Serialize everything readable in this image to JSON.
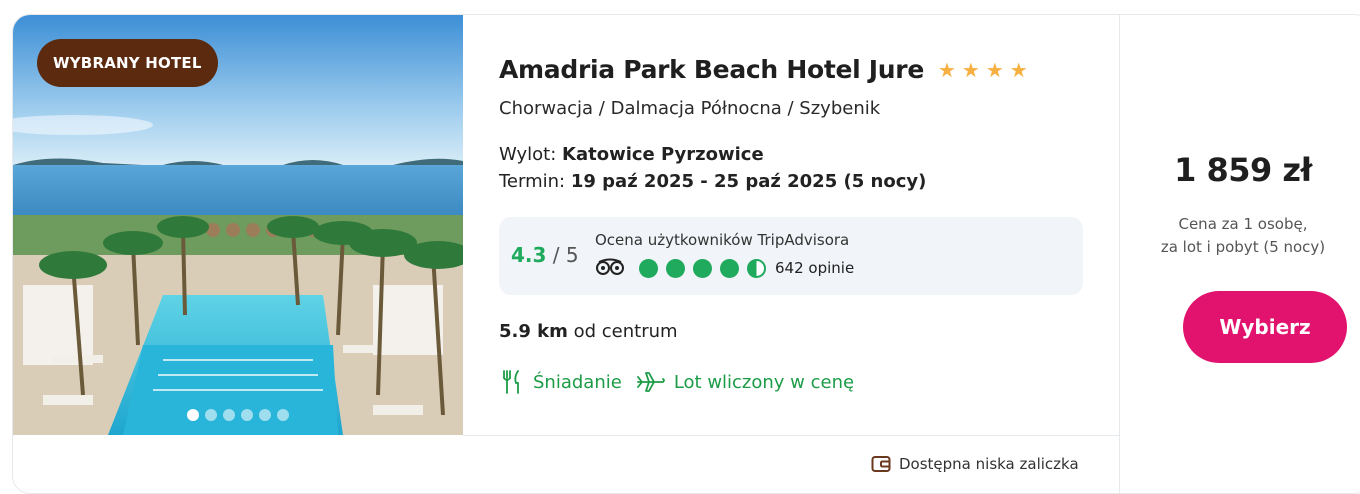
{
  "badge": "WYBRANY HOTEL",
  "hotel": {
    "name": "Amadria Park Beach Hotel Jure",
    "stars": 4,
    "location": "Chorwacja / Dalmacja Północna / Szybenik"
  },
  "trip": {
    "departure_label": "Wylot:",
    "departure_value": "Katowice Pyrzowice",
    "term_label": "Termin:",
    "term_value": "19 paź 2025 - 25 paź 2025 (5 nocy)"
  },
  "rating": {
    "score": "4.3",
    "scale": "/ 5",
    "label": "Ocena użytkowników TripAdvisora",
    "bubbles": 4.5,
    "reviews": "642 opinie"
  },
  "distance": {
    "value": "5.9 km",
    "suffix": "od centrum"
  },
  "features": [
    {
      "icon": "fork-knife-icon",
      "label": "Śniadanie"
    },
    {
      "icon": "airplane-icon",
      "label": "Lot wliczony w cenę"
    }
  ],
  "deposit": "Dostępna niska zaliczka",
  "gallery": {
    "count": 6,
    "active": 0
  },
  "price": {
    "amount": "1 859 zł",
    "note_line1": "Cena za 1 osobę,",
    "note_line2": "za lot i pobyt (5 nocy)",
    "button": "Wybierz"
  },
  "colors": {
    "badge": "#5c2a0e",
    "accent": "#e2136e",
    "green": "#1c9c47",
    "star": "#f5b041"
  }
}
